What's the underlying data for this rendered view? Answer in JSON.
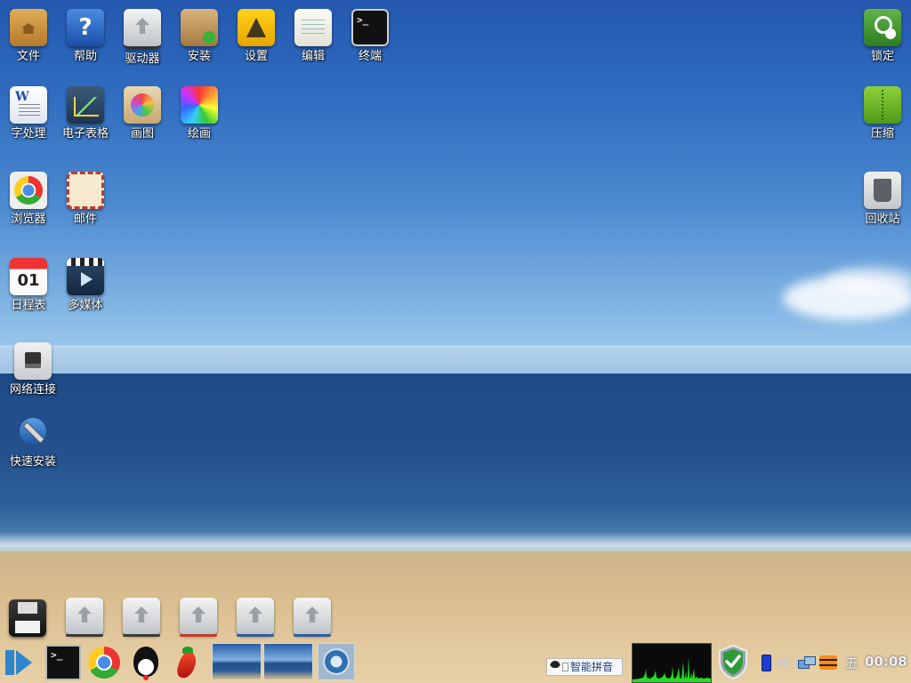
{
  "desktop": {
    "icons_left": [
      {
        "label": "文件",
        "icon": "folder-icon"
      },
      {
        "label": "帮助",
        "icon": "help-icon"
      },
      {
        "label": "驱动器",
        "icon": "drive-icon"
      },
      {
        "label": "安装",
        "icon": "package-install-icon"
      },
      {
        "label": "设置",
        "icon": "settings-icon"
      },
      {
        "label": "编辑",
        "icon": "text-editor-icon"
      },
      {
        "label": "终端",
        "icon": "terminal-icon"
      },
      {
        "label": "字处理",
        "icon": "word-processor-icon"
      },
      {
        "label": "电子表格",
        "icon": "spreadsheet-icon"
      },
      {
        "label": "画图",
        "icon": "paint-icon"
      },
      {
        "label": "绘画",
        "icon": "draw-icon"
      },
      {
        "label": "浏览器",
        "icon": "browser-icon"
      },
      {
        "label": "邮件",
        "icon": "mail-icon"
      },
      {
        "label": "日程表",
        "icon": "calendar-icon"
      },
      {
        "label": "多媒体",
        "icon": "media-player-icon"
      },
      {
        "label": "网络连接",
        "icon": "network-icon"
      },
      {
        "label": "快速安装",
        "icon": "quick-install-icon"
      }
    ],
    "icons_right": [
      {
        "label": "锁定",
        "icon": "lock-icon"
      },
      {
        "label": "压缩",
        "icon": "archive-icon"
      },
      {
        "label": "回收站",
        "icon": "trash-icon"
      }
    ],
    "terminal_glyph": ">_",
    "calendar_day": "01"
  },
  "dock": {
    "items": [
      {
        "icon": "floppy-disk-icon"
      },
      {
        "icon": "drive-icon",
        "indicator": "#3a3a3a"
      },
      {
        "icon": "drive-icon",
        "indicator": "#3a3a3a"
      },
      {
        "icon": "drive-icon",
        "indicator": "#c0392b"
      },
      {
        "icon": "drive-icon",
        "indicator": "#2b5d9a"
      },
      {
        "icon": "drive-icon",
        "indicator": "#2b5d9a"
      }
    ]
  },
  "taskbar": {
    "launchers": [
      "start-menu-icon",
      "terminal-icon",
      "browser-icon",
      "qq-penguin-icon",
      "pepper-icon"
    ],
    "terminal_glyph": ">_",
    "ime_label": "智能拼音",
    "clock_day": "五",
    "clock_time": "00:08",
    "colors": {
      "sysmon_graph": "#22dd22",
      "shield": "#2f9a3a",
      "accent": "#2f86cf"
    }
  }
}
